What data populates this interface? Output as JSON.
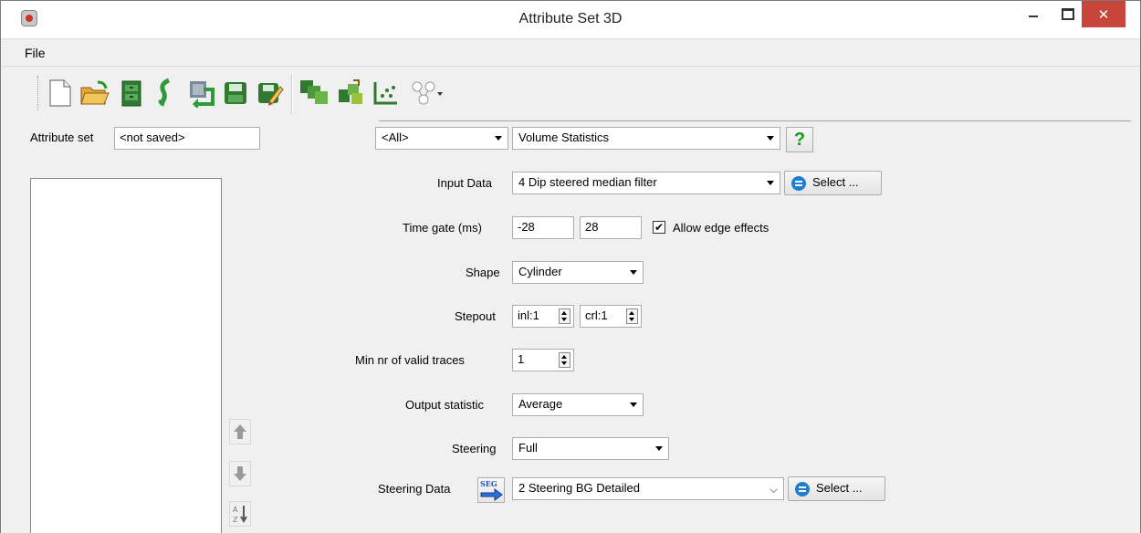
{
  "window": {
    "title": "Attribute Set 3D",
    "close_glyph": "✕"
  },
  "menu": {
    "file": "File"
  },
  "toolbar": {
    "buttons": [
      "new-icon",
      "open-icon",
      "open-set-icon",
      "import-icon",
      "reimport-icon",
      "save-icon",
      "save-as-icon",
      "evaluate-icon",
      "crossplot-icon",
      "show-graph-icon",
      "tree-icon"
    ]
  },
  "attribute_set": {
    "label": "Attribute set",
    "value": "<not saved>"
  },
  "filter_combo": {
    "value": "<All>"
  },
  "attribute_type_combo": {
    "value": "Volume Statistics"
  },
  "help": {
    "glyph": "?"
  },
  "input_data": {
    "label": "Input Data",
    "value": "4 Dip steered median filter",
    "select_label": "Select ..."
  },
  "time_gate": {
    "label": "Time gate (ms)",
    "start": "-28",
    "stop": "28",
    "edge_label": "Allow edge effects",
    "edge_checked": "✔"
  },
  "shape": {
    "label": "Shape",
    "value": "Cylinder"
  },
  "stepout": {
    "label": "Stepout",
    "inl": "inl:1",
    "crl": "crl:1"
  },
  "min_traces": {
    "label": "Min nr of valid traces",
    "value": "1"
  },
  "output_statistic": {
    "label": "Output statistic",
    "value": "Average"
  },
  "steering": {
    "label": "Steering",
    "value": "Full"
  },
  "steering_data": {
    "label": "Steering Data",
    "value": "2 Steering BG Detailed",
    "select_label": "Select ...",
    "dropdown_glyph": "⌵",
    "seg_text": "SEG"
  },
  "colors": {
    "close": "#c7453b",
    "help": "#1a9a1a",
    "select_icon": "#1f7fd4"
  }
}
